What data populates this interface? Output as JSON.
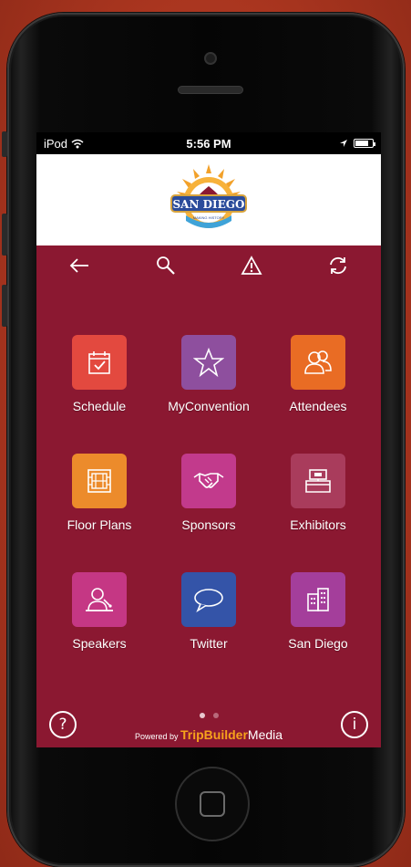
{
  "status_bar": {
    "carrier": "iPod",
    "time": "5:56 PM"
  },
  "header": {
    "logo_text": "SAN DIEGO",
    "logo_subtext": "MAKING HISTORY"
  },
  "toolbar": {
    "icons": [
      "back-arrow-icon",
      "search-icon",
      "alert-icon",
      "refresh-icon"
    ]
  },
  "tiles": [
    {
      "label": "Schedule",
      "icon": "calendar-check-icon",
      "color": "#e3493f"
    },
    {
      "label": "MyConvention",
      "icon": "star-icon",
      "color": "#8e4f9e"
    },
    {
      "label": "Attendees",
      "icon": "people-icon",
      "color": "#e96c24"
    },
    {
      "label": "Floor Plans",
      "icon": "floor-plan-icon",
      "color": "#ec8b2b"
    },
    {
      "label": "Sponsors",
      "icon": "handshake-icon",
      "color": "#c23a8c"
    },
    {
      "label": "Exhibitors",
      "icon": "booth-icon",
      "color": "#a93c5c"
    },
    {
      "label": "Speakers",
      "icon": "speaker-podium-icon",
      "color": "#c53784"
    },
    {
      "label": "Twitter",
      "icon": "speech-bubble-icon",
      "color": "#3454a8"
    },
    {
      "label": "San Diego",
      "icon": "city-buildings-icon",
      "color": "#a43e9b"
    }
  ],
  "pager": {
    "pages": 2,
    "active": 0
  },
  "footer": {
    "help_icon": "?",
    "info_icon": "i",
    "powered_prefix": "Powered by",
    "brand_main": "TripBuilder",
    "brand_suffix": "Media"
  },
  "colors": {
    "screen_bg": "#8b1831",
    "background": "#b23a24",
    "brand_orange": "#f6a21c"
  }
}
